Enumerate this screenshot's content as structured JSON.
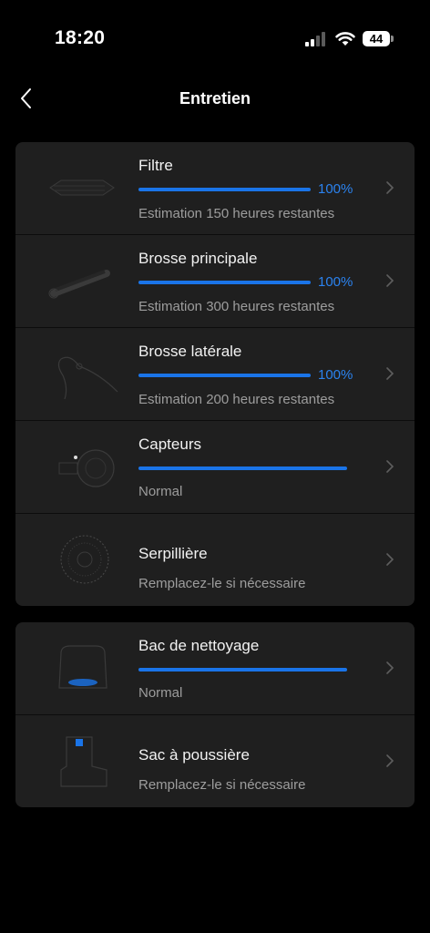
{
  "status_bar": {
    "time": "18:20",
    "battery": "44"
  },
  "nav": {
    "title": "Entretien"
  },
  "group1": [
    {
      "name": "Filtre",
      "percent_label": "100%",
      "level": 1.0,
      "subtitle": "Estimation 150 heures restantes"
    },
    {
      "name": "Brosse principale",
      "percent_label": "100%",
      "level": 1.0,
      "subtitle": "Estimation 300 heures restantes"
    },
    {
      "name": "Brosse latérale",
      "percent_label": "100%",
      "level": 1.0,
      "subtitle": "Estimation 200 heures restantes"
    },
    {
      "name": "Capteurs",
      "level": 1.0,
      "subtitle": "Normal"
    },
    {
      "name": "Serpillière",
      "subtitle": "Remplacez-le si nécessaire"
    }
  ],
  "group2": [
    {
      "name": "Bac de nettoyage",
      "level": 1.0,
      "subtitle": "Normal"
    },
    {
      "name": "Sac à poussière",
      "subtitle": "Remplacez-le si nécessaire"
    }
  ],
  "colors": {
    "accent": "#1a74e8",
    "card": "#1f1f1f",
    "background": "#000000"
  }
}
